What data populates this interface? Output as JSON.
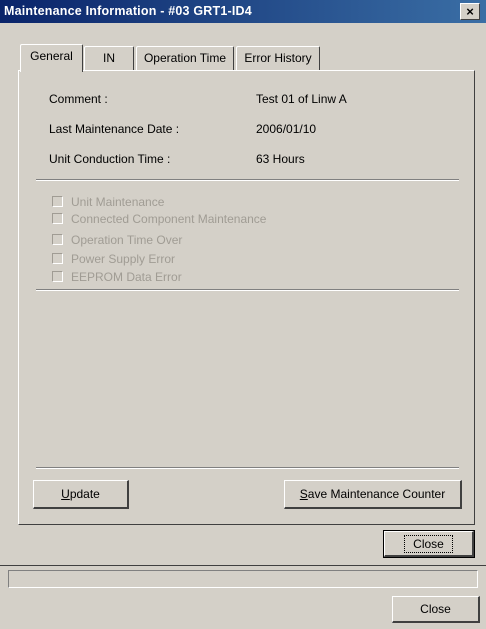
{
  "window": {
    "title": "Maintenance Information - #03 GRT1-ID4",
    "close_glyph": "×"
  },
  "tabs": [
    {
      "label": "General",
      "active": true
    },
    {
      "label": "IN",
      "active": false
    },
    {
      "label": "Operation Time",
      "active": false
    },
    {
      "label": "Error History",
      "active": false
    }
  ],
  "info": {
    "comment_label": "Comment :",
    "comment_value": "Test 01 of Linw A",
    "last_maintenance_label": "Last Maintenance Date :",
    "last_maintenance_value": "2006/01/10",
    "conduction_label": "Unit Conduction Time :",
    "conduction_value": "63 Hours"
  },
  "checkboxes": [
    {
      "label": "Unit Maintenance",
      "checked": false
    },
    {
      "label": "Connected Component Maintenance",
      "checked": false
    },
    {
      "label": "Operation Time Over",
      "checked": false
    },
    {
      "label": "Power Supply Error",
      "checked": false
    },
    {
      "label": "EEPROM Data Error",
      "checked": false
    }
  ],
  "buttons": {
    "update_mnemonic": "U",
    "update_rest": "pdate",
    "save_mnemonic": "S",
    "save_rest": "ave Maintenance Counter",
    "close_dialog": "Close",
    "close_outer": "Close"
  },
  "colors": {
    "titlebar_start": "#0a246a",
    "titlebar_end": "#3a6ea5",
    "face": "#d4d0c8",
    "disabled_text": "#a09c94"
  }
}
